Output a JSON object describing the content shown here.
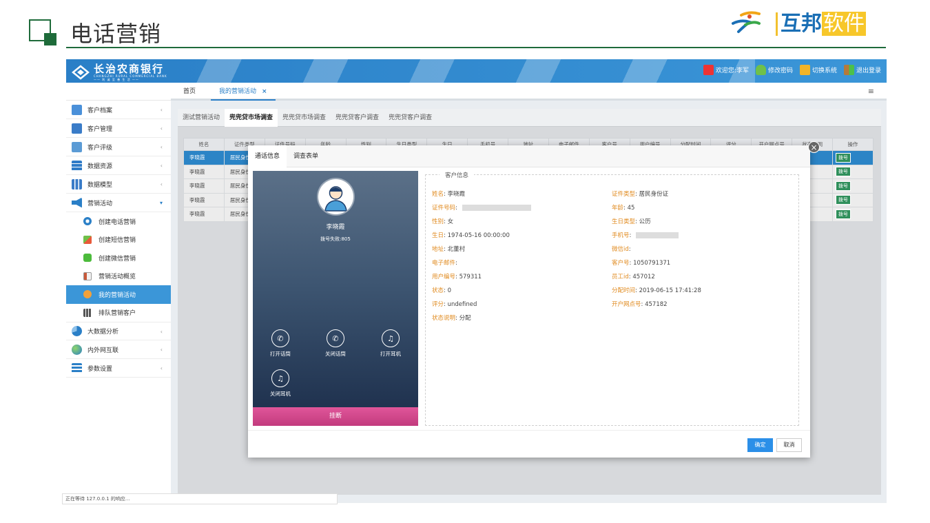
{
  "slide": {
    "title": "电话营销"
  },
  "brand": {
    "name_a": "互邦",
    "name_b": "软件"
  },
  "app": {
    "logo": {
      "line1": "长治农商银行",
      "line2": "CHANGZHI RURAL COMMERCIAL BANK",
      "line3": "—— 利 诚 至 善 生 活 ——"
    },
    "topnav": {
      "welcome": "欢迎您:李军",
      "change_password": "修改密码",
      "switch_system": "切换系统",
      "logout": "退出登录"
    },
    "tabs": [
      {
        "label": "首页"
      },
      {
        "label": "我的营销活动",
        "close": "×"
      }
    ],
    "sidebar": {
      "items": [
        {
          "label": "客户档案",
          "arrow": "‹"
        },
        {
          "label": "客户管理",
          "arrow": "‹"
        },
        {
          "label": "客户评级",
          "arrow": "‹"
        },
        {
          "label": "数据资源",
          "arrow": "‹"
        },
        {
          "label": "数据模型",
          "arrow": "‹"
        },
        {
          "label": "营销活动",
          "arrow": "▾"
        }
      ],
      "sub": [
        {
          "label": "创建电话营销"
        },
        {
          "label": "创建短信营销"
        },
        {
          "label": "创建微信营销"
        },
        {
          "label": "营销活动概览"
        },
        {
          "label": "我的营销活动"
        },
        {
          "label": "排队营销客户"
        }
      ],
      "items2": [
        {
          "label": "大数据分析",
          "arrow": "‹"
        },
        {
          "label": "内外网互联",
          "arrow": "‹"
        },
        {
          "label": "参数设置",
          "arrow": "‹"
        }
      ]
    },
    "subtabs": [
      "测试营销活动",
      "兜兜贷市场调查",
      "兜兜贷市场调查",
      "兜兜贷客户调查",
      "兜兜贷客户调查"
    ],
    "grid": {
      "headers": [
        "姓名",
        "证件类型",
        "证件号码",
        "年龄",
        "性别",
        "生日类型",
        "生日",
        "手机号",
        "地址",
        "电子邮件",
        "客户号",
        "用户编号",
        "分配时间",
        "评分",
        "开户网点号",
        "状态说明",
        "操作"
      ],
      "rows": [
        {
          "name": "李晓霞",
          "idtype": "居民身份",
          "action": "拨号"
        },
        {
          "name": "李晓霞",
          "idtype": "居民身份",
          "action": "拨号"
        },
        {
          "name": "李晓霞",
          "idtype": "居民身份",
          "action": "拨号"
        },
        {
          "name": "李晓霞",
          "idtype": "居民身份",
          "action": "拨号"
        },
        {
          "name": "李晓霞",
          "idtype": "居民身份",
          "action": "拨号"
        }
      ]
    },
    "modal": {
      "tabs": [
        "通话信息",
        "调查表单"
      ],
      "call": {
        "name": "李晓霞",
        "status": "拨号失败:805",
        "buttons": {
          "open_mic": "打开话筒",
          "close_mic": "关闭话筒",
          "open_headset": "打开耳机",
          "close_headset": "关闭耳机"
        },
        "hangup": "挂断"
      },
      "info": {
        "legend": "客户信息",
        "left": [
          {
            "k": "姓名",
            "v": "李晓霞"
          },
          {
            "k": "证件号码",
            "v": ""
          },
          {
            "k": "性别",
            "v": "女"
          },
          {
            "k": "生日",
            "v": "1974-05-16 00:00:00"
          },
          {
            "k": "地址",
            "v": "北董村"
          },
          {
            "k": "电子邮件",
            "v": ""
          },
          {
            "k": "用户编号",
            "v": "579311"
          },
          {
            "k": "状态",
            "v": "0"
          },
          {
            "k": "评分",
            "v": "undefined"
          },
          {
            "k": "状态说明",
            "v": "分配"
          }
        ],
        "right": [
          {
            "k": "证件类型",
            "v": "居民身份证"
          },
          {
            "k": "年龄",
            "v": "45"
          },
          {
            "k": "生日类型",
            "v": "公历"
          },
          {
            "k": "手机号",
            "v": ""
          },
          {
            "k": "微信id",
            "v": ""
          },
          {
            "k": "客户号",
            "v": "1050791371"
          },
          {
            "k": "员工id",
            "v": "457012"
          },
          {
            "k": "分配时间",
            "v": "2019-06-15 17:41:28"
          },
          {
            "k": "开户网点号",
            "v": "457182"
          }
        ]
      },
      "ok": "确定",
      "cancel": "取消"
    },
    "status_bar": "正在等待 127.0.0.1 的响应..."
  },
  "colors": {
    "accent": "#2a7fc7",
    "slide_green": "#1e6b3a",
    "label_orange": "#e08a1e",
    "dial_green": "#2f8f5b",
    "hangup_pink": "#d04a8c"
  }
}
